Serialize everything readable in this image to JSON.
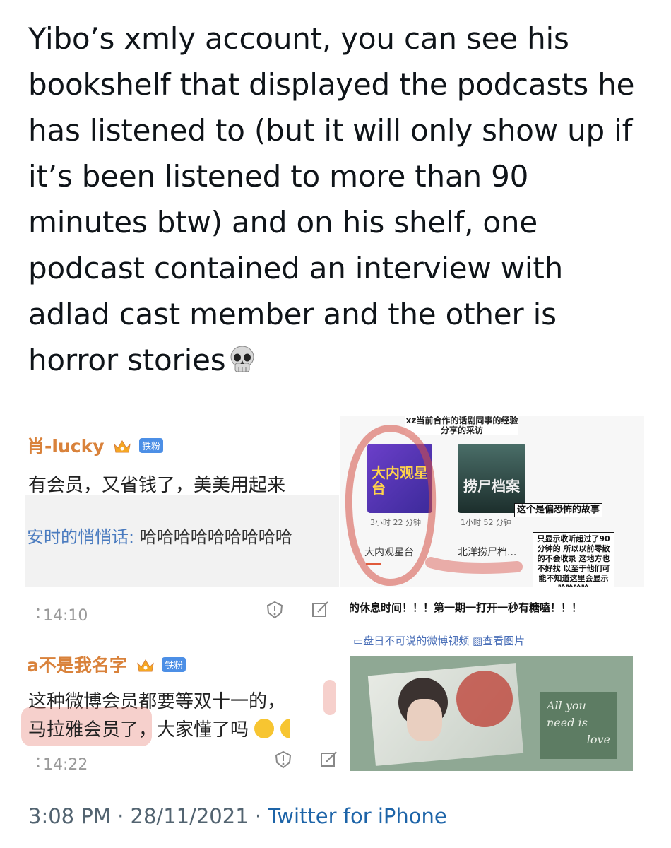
{
  "tweet": {
    "text": "Yibo’s xmly account, you can see his bookshelf that displayed the podcasts he has listened to (but it will only show up if it’s been listened to more than 90 minutes btw) and on his shelf, one podcast contained an interview with adlad cast member and the other is horror stories"
  },
  "left_panel": {
    "comment1": {
      "username": "肖-lucky",
      "badge": "铁粉",
      "text": "有会员，又省钱了，美美用起来",
      "reply_user": "安时的悄悄话:",
      "reply_text": " 哈哈哈哈哈哈哈哈哈",
      "time": "14:10"
    },
    "comment2": {
      "username": "a不是我名字",
      "badge": "铁粉",
      "line1": "这种微博会员都要等双十一的，",
      "line2": "马拉雅会员了，大家懂了吗",
      "time": "14:22"
    }
  },
  "shelf_panel": {
    "caption_top": "xz当前合作的话剧同事的经验分享的采访",
    "podcast1": {
      "cover_text": "大内观星台",
      "duration": "3小时 22 分钟",
      "name": "大内观星台"
    },
    "podcast2": {
      "cover_text": "捞尸档案",
      "duration": "1小时 52 分钟",
      "name": "北洋捞尸档..."
    },
    "horror_note": "这个是偏恐怖的故事",
    "note": "只显示收听超过了90分钟的 所以以前零散的不会收录 这地方也不好找 以至于他们可能不知道这里会显示哈哈哈哈"
  },
  "mid_caption": "的休息时间！！！第一期一打开一秒有糖嗑！！！",
  "links": {
    "video": "盘日不可说的微博视频",
    "photo": "查看图片"
  },
  "image_overlay": {
    "line1": "All you",
    "line2": "need is",
    "line3": "love"
  },
  "footer": {
    "time": "3:08 PM",
    "date": "28/11/2021",
    "app": "Twitter for iPhone"
  }
}
